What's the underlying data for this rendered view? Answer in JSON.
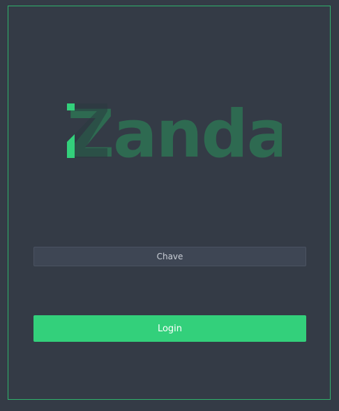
{
  "logo": {
    "text": "Zanda",
    "accent_color": "#33d07b",
    "text_color": "#2e6a51"
  },
  "login_form": {
    "key_placeholder": "Chave",
    "key_value": "",
    "login_label": "Login"
  },
  "colors": {
    "background": "#343b46",
    "frame_border": "#2fb36c",
    "button": "#33d07b",
    "input_background": "#3e4654"
  }
}
